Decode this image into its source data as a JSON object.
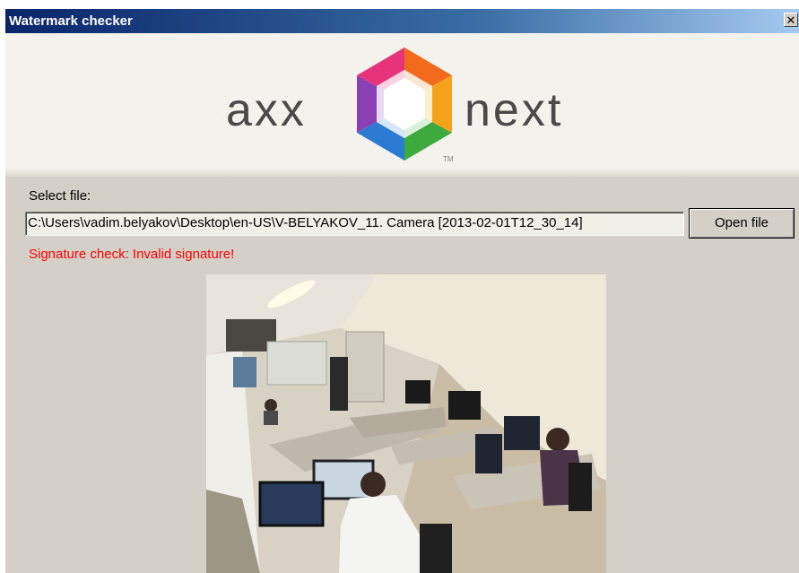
{
  "window": {
    "title": "Watermark checker",
    "close_glyph": "✕"
  },
  "banner": {
    "brand_left": "axx",
    "brand_right": "next",
    "trademark": "TM",
    "logo_icon": "axxon-hexagon-logo"
  },
  "form": {
    "select_label": "Select file:",
    "file_path": "C:\\Users\\vadim.belyakov\\Desktop\\en-US\\V-BELYAKOV_11. Camera [2013-02-01T12_30_14]",
    "open_button_label": "Open file",
    "status_text": "Signature check: Invalid signature!",
    "status_color": "#ff0000"
  },
  "preview": {
    "description_icon": "camera-frame-image"
  }
}
